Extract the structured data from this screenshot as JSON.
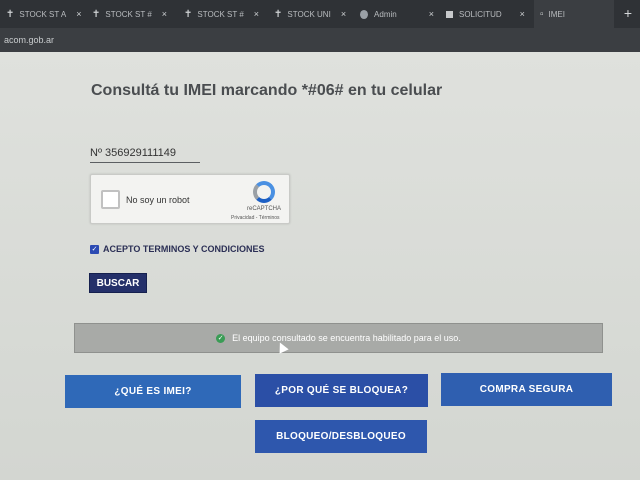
{
  "browser": {
    "tabs": [
      {
        "label": "STOCK ST A",
        "icon": "cross-icon"
      },
      {
        "label": "STOCK ST #",
        "icon": "cross-icon"
      },
      {
        "label": "STOCK ST #",
        "icon": "cross-icon"
      },
      {
        "label": "STOCK UNI",
        "icon": "cross-icon"
      },
      {
        "label": "Admin",
        "icon": "globe-icon"
      },
      {
        "label": "SOLICITUD",
        "icon": "grid-icon"
      },
      {
        "label": "IMEI",
        "icon": "page-icon"
      }
    ],
    "close_glyph": "×",
    "new_tab_glyph": "+",
    "address": "acom.gob.ar"
  },
  "main": {
    "title": "Consultá tu IMEI marcando *#06# en tu celular",
    "imei_value": "Nº  356929111149",
    "captcha": {
      "label": "No soy un robot",
      "brand": "reCAPTCHA",
      "links": "Privacidad - Términos"
    },
    "terms_label": "ACEPTO TERMINOS Y CONDICIONES",
    "search_button": "BUSCAR",
    "status_message": "El equipo consultado se encuentra habilitado para el uso.",
    "buttons": {
      "what_is_imei": "¿QUÉ ES IMEI?",
      "why_blocked": "¿POR QUÉ SE BLOQUEA?",
      "safe_purchase": "COMPRA SEGURA",
      "block_unblock": "BLOQUEO/DESBLOQUEO"
    }
  },
  "colors": {
    "primary_button": "#2f5fb0",
    "search_button": "#24306a",
    "status_bg": "#a8aaa7",
    "success_icon": "#3a9c55"
  }
}
